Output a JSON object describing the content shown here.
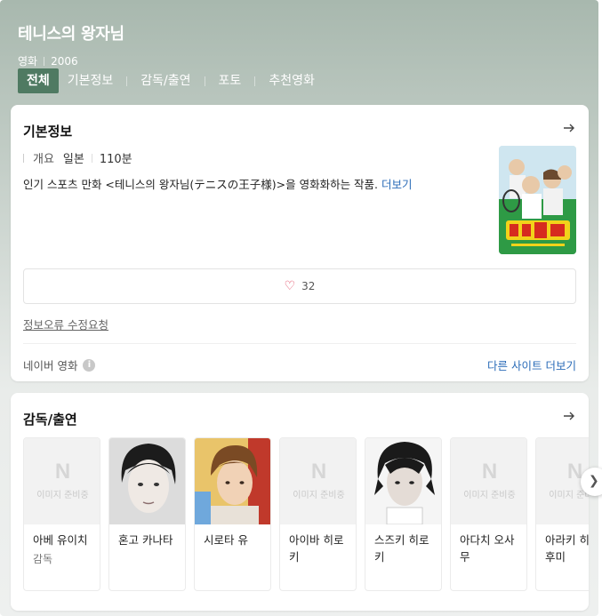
{
  "header": {
    "title": "테니스의 왕자님",
    "category": "영화",
    "year": "2006"
  },
  "tabs": [
    {
      "label": "전체",
      "active": true
    },
    {
      "label": "기본정보",
      "active": false
    },
    {
      "label": "감독/출연",
      "active": false
    },
    {
      "label": "포토",
      "active": false
    },
    {
      "label": "추천영화",
      "active": false
    }
  ],
  "basic_info": {
    "title": "기본정보",
    "overview_label": "개요",
    "country": "일본",
    "runtime": "110분",
    "description": "인기 스포츠 만화 <테니스의 왕자님(テニスの王子様)>을 영화화하는 작품.",
    "more_label": "더보기",
    "poster_icon": "movie-poster",
    "like_count": "32",
    "report_label": "정보오류 수정요청",
    "source_label": "네이버 영화",
    "other_sites_label": "다른 사이트 더보기"
  },
  "cast": {
    "title": "감독/출연",
    "no_image_letter": "N",
    "no_image_text": "이미지 준비중",
    "members": [
      {
        "name": "아베 유이치",
        "role": "감독",
        "has_photo": false
      },
      {
        "name": "혼고 카나타",
        "role": "",
        "has_photo": true
      },
      {
        "name": "시로타 유",
        "role": "",
        "has_photo": true
      },
      {
        "name": "아이바 히로키",
        "role": "",
        "has_photo": false
      },
      {
        "name": "스즈키 히로키",
        "role": "",
        "has_photo": true
      },
      {
        "name": "아다치 오사무",
        "role": "",
        "has_photo": false
      },
      {
        "name": "아라키 히로후미",
        "role": "",
        "has_photo": false
      }
    ]
  },
  "colors": {
    "accent": "#4f7a62",
    "link": "#2b6cb8",
    "heart": "#e0405a"
  }
}
